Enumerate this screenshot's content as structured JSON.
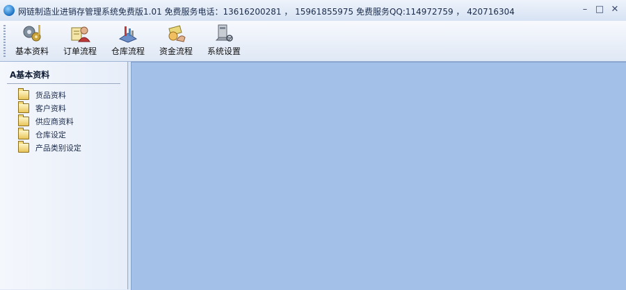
{
  "title": "网链制造业进销存管理系统免费版1.01    免费服务电话：13616200281 ， 15961855975    免费服务QQ:114972759 ， 420716304",
  "window_buttons": {
    "minimize": "–",
    "maximize": "□",
    "close": "✕"
  },
  "toolbar": [
    {
      "label": "基本资料",
      "icon": "gears-icon"
    },
    {
      "label": "订单流程",
      "icon": "order-icon"
    },
    {
      "label": "仓库流程",
      "icon": "warehouse-icon"
    },
    {
      "label": "资金流程",
      "icon": "money-icon"
    },
    {
      "label": "系统设置",
      "icon": "settings-icon"
    }
  ],
  "sidebar": {
    "section_title": "A基本资料",
    "items": [
      {
        "label": "货品资料"
      },
      {
        "label": "客户资料"
      },
      {
        "label": "供应商资料"
      },
      {
        "label": "仓库设定"
      },
      {
        "label": "产品类别设定"
      }
    ]
  },
  "colors": {
    "workspace": "#a3c1e8",
    "sidebar": "#e7eef9",
    "toolbar": "#dfe8f5"
  }
}
